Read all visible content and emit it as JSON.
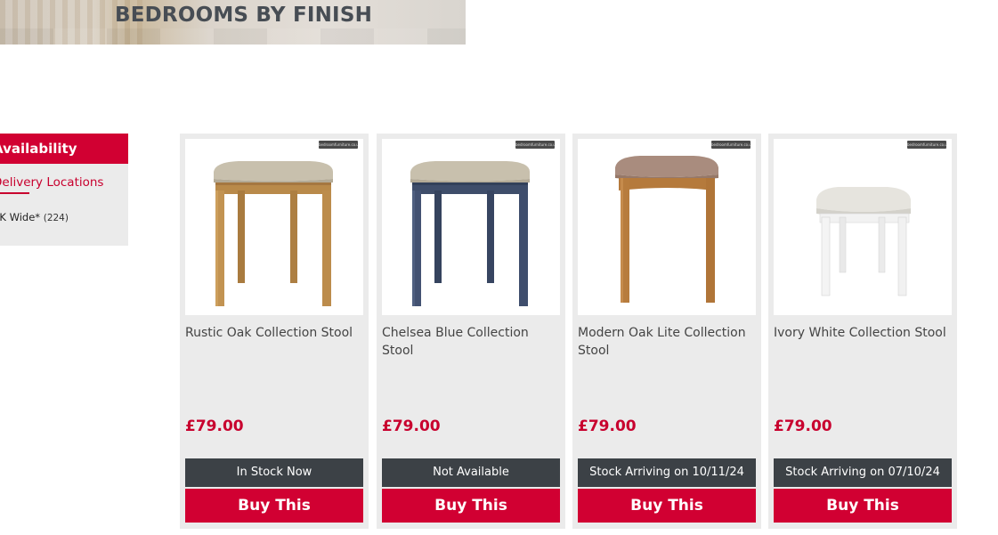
{
  "banner": {
    "title": "BEDROOMS BY FINISH"
  },
  "sidebar": {
    "header": "Availability",
    "link": "Delivery Locations",
    "option_label": "UK Wide*",
    "option_count": "(224)"
  },
  "colors": {
    "accent": "#d10032",
    "stock_bar": "#3c4146",
    "card_bg": "#ebebeb"
  },
  "brand_tag": "bedroomfurniture.co.uk",
  "products": [
    {
      "title": "Rustic Oak Collection Stool",
      "price": "£79.00",
      "stock": "In Stock Now",
      "button": "Buy This"
    },
    {
      "title": "Chelsea Blue Collection Stool",
      "price": "£79.00",
      "stock": "Not Available",
      "button": "Buy This"
    },
    {
      "title": "Modern Oak Lite Collection Stool",
      "price": "£79.00",
      "stock": "Stock Arriving on 10/11/24",
      "button": "Buy This"
    },
    {
      "title": "Ivory White Collection Stool",
      "price": "£79.00",
      "stock": "Stock Arriving on 07/10/24",
      "button": "Buy This"
    }
  ]
}
